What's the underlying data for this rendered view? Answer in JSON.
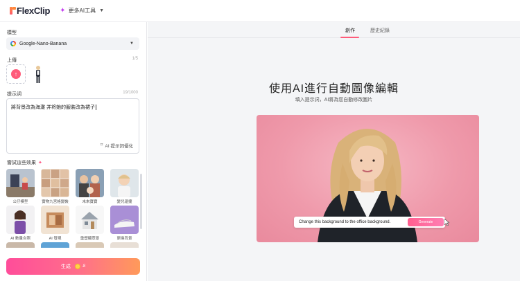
{
  "header": {
    "logo_text": "FlexClip",
    "ai_tools_label": "更多AI工具"
  },
  "sidebar": {
    "model": {
      "label": "模型",
      "selected": "Google-Nano-Banana"
    },
    "upload": {
      "label": "上傳",
      "count": "1/5"
    },
    "prompt": {
      "label": "提示詞",
      "count": "19/1000",
      "value": "將背景改為海灘 并将她的服裝改為裙子",
      "optimize_label": "AI 提示詞優化"
    },
    "effects": {
      "label": "嘗試這些效果",
      "items": [
        {
          "caption": "公仔模型"
        },
        {
          "caption": "實物九宮格變裝"
        },
        {
          "caption": "未來寶寶"
        },
        {
          "caption": "變兒還捷"
        },
        {
          "caption": "AI 數量合照"
        },
        {
          "caption": "AI 發現"
        },
        {
          "caption": "重塑顯眾景"
        },
        {
          "caption": "更換背景"
        },
        {
          "caption": ""
        },
        {
          "caption": ""
        },
        {
          "caption": ""
        },
        {
          "caption": ""
        }
      ]
    },
    "generate": {
      "label": "生成",
      "cost": "-8"
    }
  },
  "main": {
    "tabs": [
      {
        "label": "創作",
        "active": true
      },
      {
        "label": "歷史紀錄",
        "active": false
      }
    ],
    "title": "使用AI進行自動圖像編輯",
    "subtitle": "填入提示詞，AI將為您自動修改圖片",
    "demo": {
      "prompt": "Change this background to the office background.",
      "button": "Generate"
    }
  },
  "colors": {
    "accent": "#ff5b7a",
    "gradient_start": "#ff4d9a",
    "gradient_end": "#ff9a5a",
    "preview_bg": "#ef9aab"
  }
}
